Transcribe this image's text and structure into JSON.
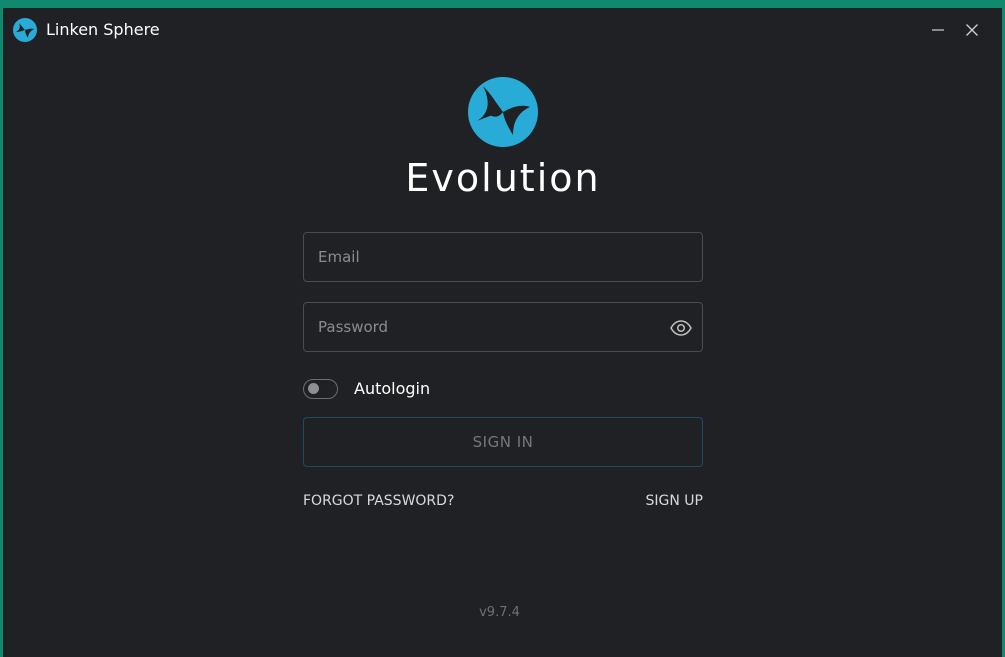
{
  "titlebar": {
    "title": "Linken Sphere",
    "logo_icon": "linken-sphere-logo-icon",
    "minimize_icon": "minimize-icon",
    "close_icon": "close-icon"
  },
  "brand": {
    "name": "Evolution",
    "logo_color": "#29abd8"
  },
  "login": {
    "email_placeholder": "Email",
    "email_value": "",
    "password_placeholder": "Password",
    "password_value": "",
    "eye_icon": "eye-icon",
    "autologin_label": "Autologin",
    "autologin_enabled": false,
    "sign_in_label": "SIGN IN",
    "forgot_password_label": "FORGOT PASSWORD?",
    "sign_up_label": "SIGN UP"
  },
  "footer": {
    "version": "v9.7.4"
  },
  "colors": {
    "window_bg": "#202124",
    "frame": "#0f8a6e",
    "accent": "#29abd8"
  }
}
